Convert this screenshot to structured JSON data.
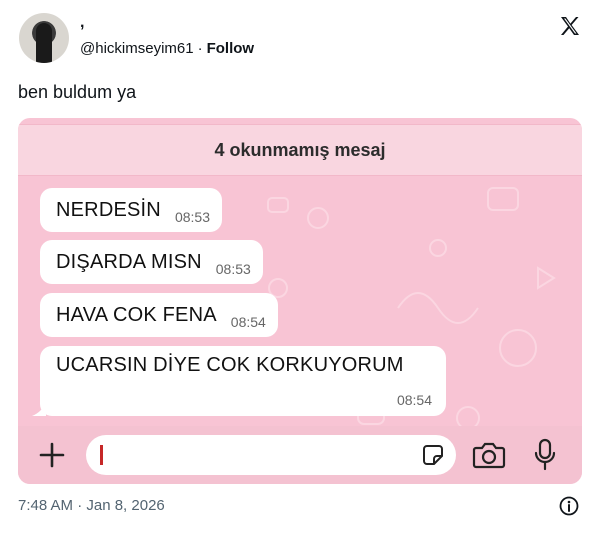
{
  "tweet": {
    "display_name": ",",
    "handle": "@hickimseyim61",
    "separator": "·",
    "follow_label": "Follow",
    "text": "ben buldum ya",
    "timestamp": "7:48 AM · Jan 8, 2026"
  },
  "chat": {
    "unread_label": "4 okunmamış mesaj",
    "messages": [
      {
        "text": "NERDESİN",
        "time": "08:53"
      },
      {
        "text": "DIŞARDA MISN",
        "time": "08:53"
      },
      {
        "text": "HAVA COK FENA",
        "time": "08:54"
      },
      {
        "text": "UCARSIN DİYE COK KORKUYORUM",
        "time": "08:54"
      }
    ]
  },
  "icons": {
    "x_logo": "x-logo-icon",
    "plus": "plus-icon",
    "sticker": "sticker-icon",
    "camera": "camera-icon",
    "mic": "microphone-icon",
    "info": "info-icon"
  },
  "colors": {
    "chat_background": "#f8c4d4",
    "bubble": "#ffffff",
    "cursor": "#c62828"
  }
}
